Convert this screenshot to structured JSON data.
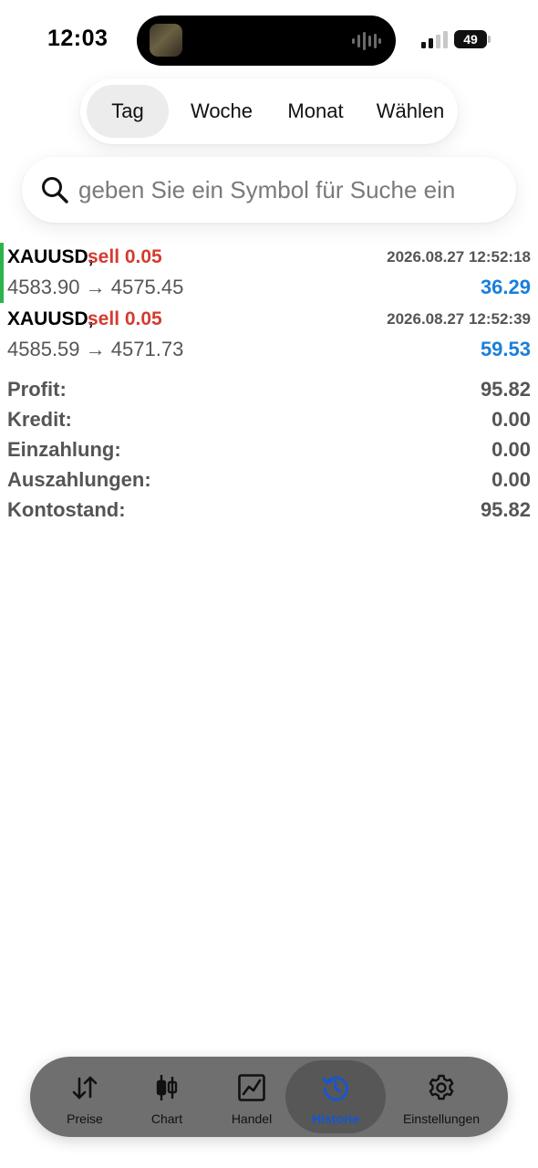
{
  "status_bar": {
    "time": "12:03",
    "battery": "49"
  },
  "period_tabs": [
    {
      "label": "Tag",
      "active": true
    },
    {
      "label": "Woche",
      "active": false
    },
    {
      "label": "Monat",
      "active": false
    },
    {
      "label": "Wählen",
      "active": false
    }
  ],
  "search": {
    "placeholder": "geben Sie ein Symbol für Suche ein",
    "value": ""
  },
  "trades": [
    {
      "symbol": "XAUUSD,",
      "side": "sell 0.05",
      "time": "2026.08.27 12:52:18",
      "open_price": "4583.90",
      "arrow": "→",
      "close_price": "4575.45",
      "profit": "36.29"
    },
    {
      "symbol": "XAUUSD,",
      "side": "sell 0.05",
      "time": "2026.08.27 12:52:39",
      "open_price": "4585.59",
      "arrow": "→",
      "close_price": "4571.73",
      "profit": "59.53"
    }
  ],
  "summary": [
    {
      "label": "Profit:",
      "value": "95.82"
    },
    {
      "label": "Kredit:",
      "value": "0.00"
    },
    {
      "label": "Einzahlung:",
      "value": "0.00"
    },
    {
      "label": "Auszahlungen:",
      "value": "0.00"
    },
    {
      "label": "Kontostand:",
      "value": "95.82"
    }
  ],
  "tabbar": [
    {
      "label": "Preise",
      "icon": "arrows-up-down-icon",
      "active": false
    },
    {
      "label": "Chart",
      "icon": "candlestick-icon",
      "active": false
    },
    {
      "label": "Handel",
      "icon": "line-chart-icon",
      "active": false
    },
    {
      "label": "Historie",
      "icon": "history-icon",
      "active": true
    },
    {
      "label": "Einstellungen",
      "icon": "gear-icon",
      "active": false
    }
  ],
  "colors": {
    "sell": "#d43b30",
    "profit": "#1a7fdb",
    "active_tab": "#1356d6",
    "selected_marker": "#2bb44a"
  }
}
